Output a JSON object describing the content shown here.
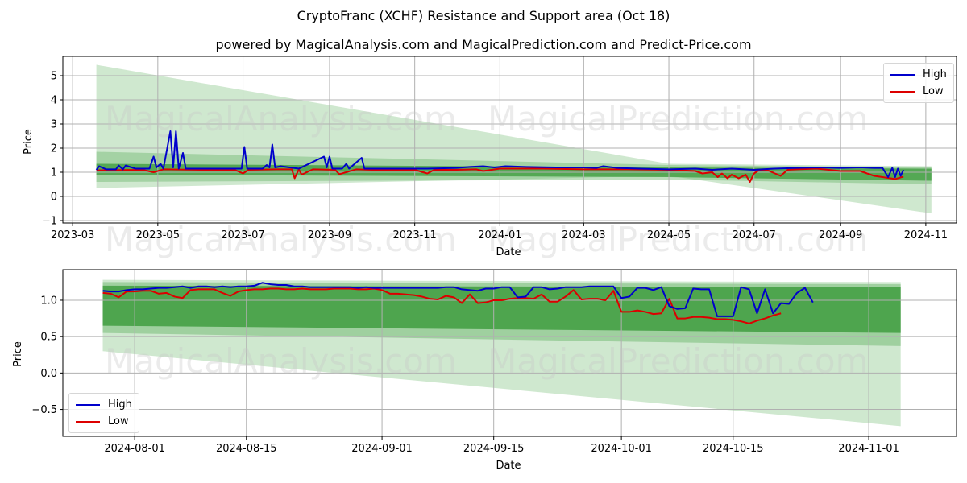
{
  "title": "CryptoFranc (XCHF) Resistance and Support area (Oct 18)",
  "subtitle": "powered by MagicalAnalysis.com and MagicalPrediction.com and Predict-Price.com",
  "watermarks": [
    "MagicalAnalysis.com",
    "MagicalPrediction.com"
  ],
  "colors": {
    "high": "#0000cc",
    "low": "#dd0000",
    "band_dark": "#3a9a3a",
    "band_light": "#c9e5c9"
  },
  "chart_data": [
    {
      "type": "line",
      "name": "full-history",
      "xlabel": "Date",
      "ylabel": "Price",
      "ylim": [
        -1.1,
        5.8
      ],
      "yticks": [
        -1,
        0,
        1,
        2,
        3,
        4,
        5
      ],
      "xlim": [
        "2023-02-22",
        "2024-11-23"
      ],
      "xticks": [
        "2023-03",
        "2023-05",
        "2023-07",
        "2023-09",
        "2023-11",
        "2024-01",
        "2024-03",
        "2024-05",
        "2024-07",
        "2024-09",
        "2024-11"
      ],
      "xtick_dates": [
        "2023-03-01",
        "2023-05-01",
        "2023-07-01",
        "2023-09-01",
        "2023-11-01",
        "2024-01-01",
        "2024-03-01",
        "2024-05-01",
        "2024-07-01",
        "2024-09-01",
        "2024-11-01"
      ],
      "grid": true,
      "legend": {
        "position": "top-right",
        "entries": [
          "High",
          "Low"
        ]
      },
      "bands": {
        "x": [
          "2023-03-18",
          "2024-05-01",
          "2024-11-05"
        ],
        "outer_upper": [
          5.45,
          1.35,
          1.25
        ],
        "outer_lower": [
          0.35,
          0.85,
          -0.7
        ],
        "inner_upper": [
          1.85,
          1.3,
          1.2
        ],
        "inner_lower": [
          0.6,
          0.7,
          0.5
        ],
        "core_upper": [
          1.35,
          1.2,
          1.15
        ],
        "core_lower": [
          0.9,
          0.8,
          0.65
        ]
      },
      "series": [
        {
          "name": "High",
          "x": [
            "2023-03-18",
            "2023-03-20",
            "2023-03-25",
            "2023-04-01",
            "2023-04-03",
            "2023-04-06",
            "2023-04-08",
            "2023-04-15",
            "2023-04-20",
            "2023-04-25",
            "2023-04-28",
            "2023-04-30",
            "2023-05-03",
            "2023-05-05",
            "2023-05-10",
            "2023-05-12",
            "2023-05-14",
            "2023-05-16",
            "2023-05-19",
            "2023-05-21",
            "2023-05-24",
            "2023-06-10",
            "2023-06-20",
            "2023-06-30",
            "2023-07-02",
            "2023-07-04",
            "2023-07-06",
            "2023-07-15",
            "2023-07-18",
            "2023-07-20",
            "2023-07-22",
            "2023-07-24",
            "2023-07-28",
            "2023-08-10",
            "2023-08-28",
            "2023-08-30",
            "2023-09-01",
            "2023-09-03",
            "2023-09-10",
            "2023-09-13",
            "2023-09-15",
            "2023-09-24",
            "2023-09-26",
            "2023-09-28",
            "2023-10-20",
            "2023-11-10",
            "2023-12-01",
            "2023-12-10",
            "2023-12-20",
            "2023-12-28",
            "2024-01-05",
            "2024-01-20",
            "2024-02-10",
            "2024-03-01",
            "2024-03-10",
            "2024-03-15",
            "2024-03-25",
            "2024-04-10",
            "2024-05-01",
            "2024-05-20",
            "2024-06-01",
            "2024-06-15",
            "2024-07-01",
            "2024-07-15",
            "2024-08-01",
            "2024-08-15",
            "2024-09-01",
            "2024-09-15",
            "2024-09-25",
            "2024-10-01",
            "2024-10-05",
            "2024-10-08",
            "2024-10-10",
            "2024-10-12",
            "2024-10-14",
            "2024-10-16"
          ],
          "values": [
            1.1,
            1.25,
            1.12,
            1.12,
            1.28,
            1.12,
            1.28,
            1.15,
            1.15,
            1.15,
            1.65,
            1.2,
            1.35,
            1.15,
            2.7,
            1.2,
            2.7,
            1.15,
            1.8,
            1.15,
            1.15,
            1.15,
            1.15,
            1.15,
            2.05,
            1.15,
            1.15,
            1.15,
            1.3,
            1.2,
            2.15,
            1.2,
            1.25,
            1.15,
            1.65,
            1.2,
            1.65,
            1.15,
            1.15,
            1.35,
            1.15,
            1.6,
            1.15,
            1.15,
            1.15,
            1.15,
            1.18,
            1.22,
            1.25,
            1.2,
            1.25,
            1.22,
            1.2,
            1.2,
            1.18,
            1.25,
            1.18,
            1.15,
            1.12,
            1.15,
            1.1,
            1.15,
            1.1,
            1.15,
            1.18,
            1.2,
            1.18,
            1.2,
            1.18,
            1.18,
            0.8,
            1.18,
            0.8,
            1.15,
            0.85,
            1.1
          ]
        },
        {
          "name": "Low",
          "x": [
            "2023-03-18",
            "2023-04-20",
            "2023-04-28",
            "2023-05-05",
            "2023-06-01",
            "2023-06-25",
            "2023-07-01",
            "2023-07-05",
            "2023-07-25",
            "2023-08-05",
            "2023-08-07",
            "2023-08-10",
            "2023-08-12",
            "2023-08-20",
            "2023-09-05",
            "2023-09-08",
            "2023-09-20",
            "2023-10-01",
            "2023-11-01",
            "2023-11-10",
            "2023-11-15",
            "2023-12-01",
            "2023-12-15",
            "2023-12-20",
            "2024-01-01",
            "2024-02-01",
            "2024-03-01",
            "2024-04-01",
            "2024-05-01",
            "2024-05-20",
            "2024-05-25",
            "2024-06-01",
            "2024-06-05",
            "2024-06-08",
            "2024-06-12",
            "2024-06-15",
            "2024-06-20",
            "2024-06-25",
            "2024-06-28",
            "2024-07-01",
            "2024-07-05",
            "2024-07-10",
            "2024-07-20",
            "2024-07-25",
            "2024-08-01",
            "2024-08-15",
            "2024-09-01",
            "2024-09-15",
            "2024-09-25",
            "2024-10-01",
            "2024-10-10",
            "2024-10-16"
          ],
          "values": [
            1.08,
            1.1,
            1.0,
            1.12,
            1.1,
            1.1,
            0.95,
            1.1,
            1.12,
            1.12,
            0.75,
            1.12,
            0.9,
            1.12,
            1.1,
            0.92,
            1.12,
            1.1,
            1.1,
            0.95,
            1.1,
            1.1,
            1.12,
            1.05,
            1.15,
            1.15,
            1.12,
            1.12,
            1.1,
            1.05,
            0.95,
            1.0,
            0.8,
            0.95,
            0.75,
            0.9,
            0.75,
            0.9,
            0.6,
            0.95,
            1.1,
            1.1,
            0.85,
            1.1,
            1.12,
            1.15,
            1.05,
            1.05,
            0.85,
            0.8,
            0.72,
            0.82
          ]
        }
      ]
    },
    {
      "type": "line",
      "name": "recent-detail",
      "xlabel": "Date",
      "ylabel": "Price",
      "ylim": [
        -0.87,
        1.42
      ],
      "yticks": [
        -0.5,
        0.0,
        0.5,
        1.0
      ],
      "ytick_labels": [
        "−0.5",
        "0.0",
        "0.5",
        "1.0"
      ],
      "xlim": [
        "2024-07-23",
        "2024-11-12"
      ],
      "xticks": [
        "2024-08-01",
        "2024-08-15",
        "2024-09-01",
        "2024-09-15",
        "2024-10-01",
        "2024-10-15",
        "2024-11-01"
      ],
      "grid": true,
      "legend": {
        "position": "bottom-left",
        "entries": [
          "High",
          "Low"
        ]
      },
      "bands": {
        "x": [
          "2024-07-28",
          "2024-11-05"
        ],
        "outer_upper": [
          1.28,
          1.25
        ],
        "outer_lower": [
          0.3,
          -0.73
        ],
        "mid_upper": [
          1.25,
          1.22
        ],
        "mid_lower": [
          0.55,
          0.37
        ],
        "core_upper": [
          1.2,
          1.18
        ],
        "core_lower": [
          0.65,
          0.55
        ]
      },
      "series": [
        {
          "name": "High",
          "x_start": "2024-07-28",
          "step_days": 1,
          "values": [
            1.13,
            1.12,
            1.12,
            1.14,
            1.15,
            1.15,
            1.16,
            1.17,
            1.17,
            1.18,
            1.19,
            1.17,
            1.19,
            1.19,
            1.18,
            1.19,
            1.18,
            1.19,
            1.19,
            1.2,
            1.24,
            1.22,
            1.21,
            1.21,
            1.19,
            1.19,
            1.18,
            1.18,
            1.18,
            1.18,
            1.18,
            1.18,
            1.17,
            1.18,
            1.17,
            1.17,
            1.17,
            1.17,
            1.17,
            1.17,
            1.17,
            1.17,
            1.17,
            1.18,
            1.18,
            1.15,
            1.14,
            1.13,
            1.16,
            1.16,
            1.18,
            1.18,
            1.04,
            1.05,
            1.18,
            1.18,
            1.15,
            1.16,
            1.18,
            1.18,
            1.18,
            1.19,
            1.19,
            1.19,
            1.19,
            1.03,
            1.05,
            1.17,
            1.17,
            1.14,
            1.18,
            0.92,
            0.88,
            0.89,
            1.16,
            1.15,
            1.15,
            0.78,
            0.78,
            0.78,
            1.18,
            1.15,
            0.82,
            1.15,
            0.82,
            0.96,
            0.95,
            1.1,
            1.17,
            0.97
          ]
        },
        {
          "name": "Low",
          "x_start": "2024-07-28",
          "step_days": 1,
          "values": [
            1.1,
            1.09,
            1.04,
            1.12,
            1.12,
            1.13,
            1.13,
            1.09,
            1.1,
            1.05,
            1.03,
            1.14,
            1.15,
            1.15,
            1.15,
            1.1,
            1.06,
            1.12,
            1.14,
            1.15,
            1.15,
            1.16,
            1.16,
            1.15,
            1.15,
            1.16,
            1.15,
            1.15,
            1.15,
            1.16,
            1.16,
            1.16,
            1.15,
            1.15,
            1.16,
            1.14,
            1.09,
            1.09,
            1.08,
            1.07,
            1.05,
            1.02,
            1.01,
            1.06,
            1.04,
            0.96,
            1.08,
            0.96,
            0.97,
            1.0,
            1.0,
            1.02,
            1.03,
            1.03,
            1.02,
            1.08,
            0.98,
            0.98,
            1.05,
            1.14,
            1.01,
            1.02,
            1.02,
            1.0,
            1.13,
            0.84,
            0.84,
            0.86,
            0.84,
            0.81,
            0.82,
            1.02,
            0.75,
            0.75,
            0.77,
            0.77,
            0.76,
            0.74,
            0.74,
            0.73,
            0.71,
            0.68,
            0.72,
            0.75,
            0.79,
            0.82
          ]
        }
      ]
    }
  ]
}
